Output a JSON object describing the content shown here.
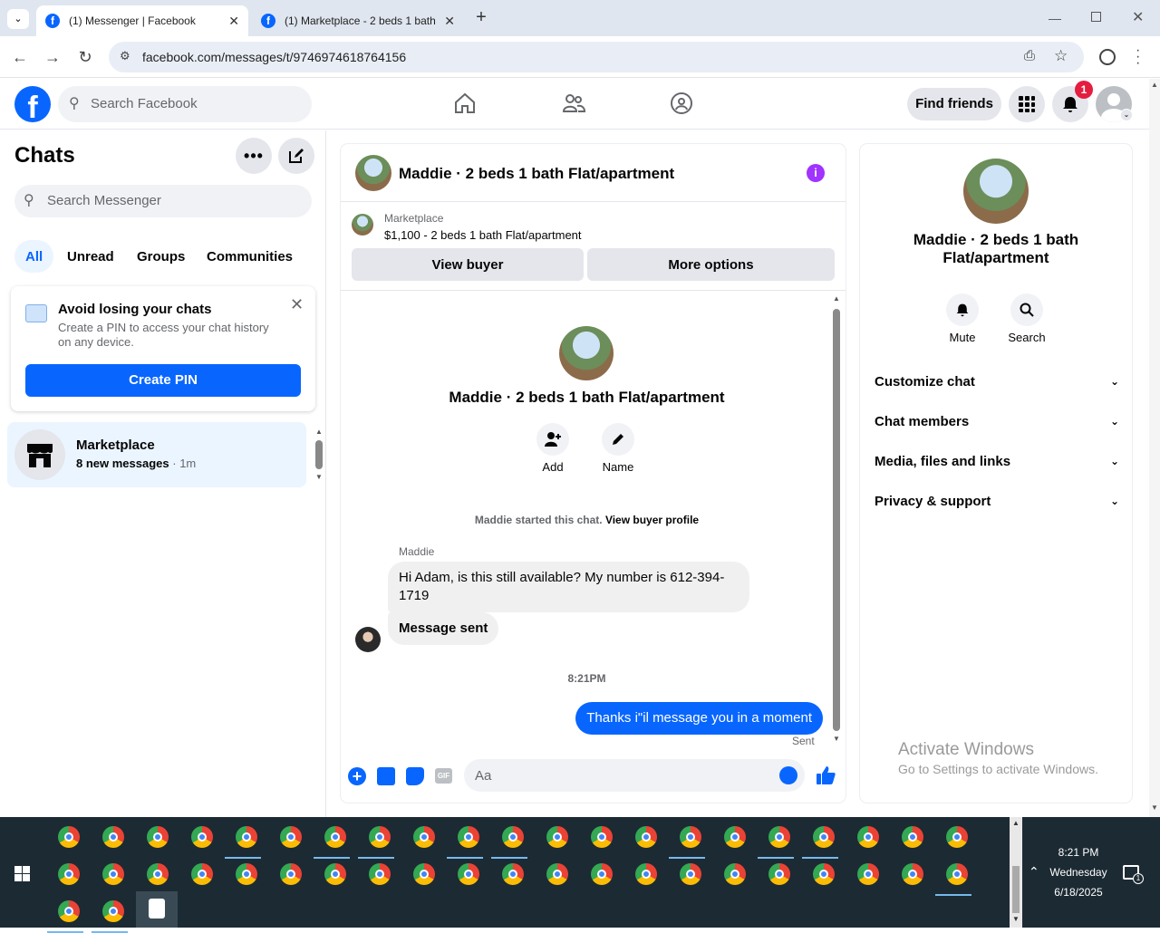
{
  "browser": {
    "tabs": [
      {
        "title": "(1) Messenger | Facebook",
        "active": true
      },
      {
        "title": "(1) Marketplace - 2 beds 1 bath",
        "active": false
      }
    ],
    "url": "facebook.com/messages/t/9746974618764156"
  },
  "fbnav": {
    "search_placeholder": "Search Facebook",
    "find_friends": "Find friends",
    "notif_count": "1"
  },
  "chats": {
    "title": "Chats",
    "search_placeholder": "Search Messenger",
    "filters": [
      "All",
      "Unread",
      "Groups",
      "Communities"
    ],
    "pin_card": {
      "title": "Avoid losing your chats",
      "body": "Create a PIN to access your chat history on any device.",
      "button": "Create PIN"
    },
    "items": [
      {
        "name": "Marketplace",
        "preview": "8 new messages",
        "time": "· 1m"
      }
    ]
  },
  "conversation": {
    "header_title": "Maddie · 2 beds 1 bath Flat/apartment",
    "listing": {
      "label": "Marketplace",
      "title": "$1,100 - 2 beds 1 bath Flat/apartment"
    },
    "view_buyer": "View buyer",
    "more_options": "More options",
    "intro_name": "Maddie · 2 beds 1 bath Flat/apartment",
    "add_label": "Add",
    "name_label": "Name",
    "started_text": "Maddie started this chat.",
    "view_profile": "View buyer profile",
    "sender": "Maddie",
    "msg1": "Hi Adam, is this still available? My number is 612-394-1719",
    "msg2": "Message sent",
    "timestamp": "8:21PM",
    "my_msg": "Thanks i\"il message you in a moment",
    "sent_status": "Sent",
    "composer_placeholder": "Aa"
  },
  "info": {
    "title": "Maddie · 2 beds 1 bath Flat/apartment",
    "mute": "Mute",
    "search": "Search",
    "sections": [
      "Customize chat",
      "Chat members",
      "Media, files and links",
      "Privacy & support"
    ],
    "watermark_title": "Activate Windows",
    "watermark_sub": "Go to Settings to activate Windows."
  },
  "taskbar": {
    "time": "8:21 PM",
    "day": "Wednesday",
    "date": "6/18/2025",
    "notif": "1"
  },
  "colors": {
    "fb_blue": "#0866ff",
    "accent_purple": "#a033ff",
    "notif_red": "#e41e3f",
    "taskbar": "#1c2a33"
  }
}
